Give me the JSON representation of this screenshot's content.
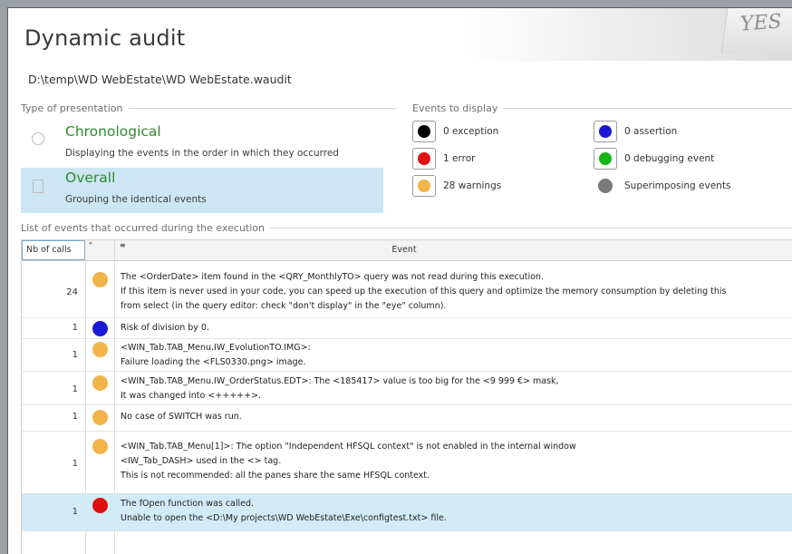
{
  "window": {
    "title": "Dynamic audit",
    "watermark": "YES",
    "file_path": "D:\\temp\\WD WebEstate\\WD WebEstate.waudit"
  },
  "presentation": {
    "header": "Type of presentation",
    "options": [
      {
        "label": "Chronological",
        "description": "Displaying the events in the order in which they occurred",
        "selected": false
      },
      {
        "label": "Overall",
        "description": "Grouping the identical events",
        "selected": true
      }
    ]
  },
  "events_to_display": {
    "header": "Events to display",
    "items": [
      {
        "label": "0 exception",
        "color": "#000000"
      },
      {
        "label": "0 assertion",
        "color": "#1a1ad6"
      },
      {
        "label": "1 error",
        "color": "#e01010"
      },
      {
        "label": "0 debugging event",
        "color": "#18b418"
      },
      {
        "label": "28 warnings",
        "color": "#f2b44a"
      },
      {
        "label": "Superimposing events",
        "color": "#7a7a7a"
      }
    ]
  },
  "event_list": {
    "header": "List of events that occurred during the execution",
    "columns": {
      "nb_calls": "Nb of calls",
      "event": "Event",
      "sort_mark": "°",
      "icon_mark": "≡"
    },
    "rows": [
      {
        "nb": "24",
        "type": "warning",
        "color": "#f2b44a",
        "lines": [
          "The <OrderDate> item found in the <QRY_MonthlyTO> query was not read during this execution.",
          "If this item is never used in your code, you can speed up the execution of this query and optimize the memory consumption by deleting this",
          "from select (in the query editor: check \"don't display\" in the \"eye\" column)."
        ]
      },
      {
        "nb": "1",
        "type": "assertion",
        "color": "#1a1ad6",
        "lines": [
          "Risk of division by 0."
        ]
      },
      {
        "nb": "1",
        "type": "warning",
        "color": "#f2b44a",
        "lines": [
          "<WIN_Tab.TAB_Menu.IW_EvolutionTO.IMG>:",
          "Failure loading the <FLS0330.png> image."
        ]
      },
      {
        "nb": "1",
        "type": "warning",
        "color": "#f2b44a",
        "lines": [
          "<WIN_Tab.TAB_Menu.IW_OrderStatus.EDT>: The <185417> value is too big for the <9 999 €> mask,",
          "It was changed into <+++++>."
        ]
      },
      {
        "nb": "1",
        "type": "warning",
        "color": "#f2b44a",
        "lines": [
          "No case of SWITCH was run."
        ]
      },
      {
        "nb": "1",
        "type": "warning",
        "color": "#f2b44a",
        "lines": [
          "<WIN_Tab.TAB_Menu[1]>: The option \"Independent HFSQL context\" is not enabled in the internal window",
          "<IW_Tab_DASH> used in the <> tag.",
          "This is not recommended: all the panes share the same HFSQL context."
        ]
      },
      {
        "nb": "1",
        "type": "error",
        "color": "#e01010",
        "selected": true,
        "lines": [
          "The fOpen function was called.",
          "Unable to open the <D:\\My projects\\WD WebEstate\\Exe\\configtest.txt> file."
        ]
      }
    ]
  }
}
